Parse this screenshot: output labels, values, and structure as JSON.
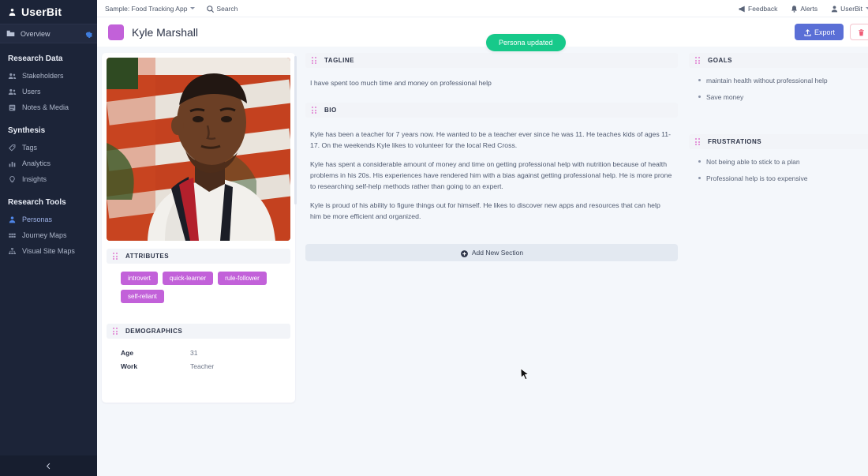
{
  "sidebar": {
    "brand": "UserBit",
    "brand_icon": "person-badge-icon",
    "overview": {
      "label": "Overview",
      "icon": "folder-icon",
      "settings_icon": "gear-icon"
    },
    "groups": [
      {
        "title": "Research Data",
        "items": [
          {
            "label": "Stakeholders",
            "icon": "people-icon",
            "active": false
          },
          {
            "label": "Users",
            "icon": "user-group-icon",
            "active": false
          },
          {
            "label": "Notes & Media",
            "icon": "notes-icon",
            "active": false
          }
        ]
      },
      {
        "title": "Synthesis",
        "items": [
          {
            "label": "Tags",
            "icon": "tag-icon",
            "active": false
          },
          {
            "label": "Analytics",
            "icon": "bar-chart-icon",
            "active": false
          },
          {
            "label": "Insights",
            "icon": "lightbulb-icon",
            "active": false
          }
        ]
      },
      {
        "title": "Research Tools",
        "items": [
          {
            "label": "Personas",
            "icon": "persona-icon",
            "active": true
          },
          {
            "label": "Journey Maps",
            "icon": "grid-icon",
            "active": false
          },
          {
            "label": "Visual Site Maps",
            "icon": "sitemap-icon",
            "active": false
          }
        ]
      }
    ],
    "collapse_icon": "chevron-left-icon"
  },
  "topbar": {
    "project": "Sample: Food Tracking App",
    "search": "Search",
    "search_icon": "search-icon",
    "feedback": "Feedback",
    "feedback_icon": "megaphone-icon",
    "alerts": "Alerts",
    "alerts_icon": "bell-icon",
    "account": "UserBit",
    "account_icon": "user-icon",
    "account_caret_icon": "chevron-down-icon"
  },
  "page": {
    "persona_name": "Kyle Marshall",
    "persona_color": "#c261d9",
    "export_label": "Export",
    "export_icon": "upload-icon",
    "delete_icon": "trash-icon",
    "toast": "Persona updated"
  },
  "left_column": {
    "photo_alt": "Portrait of Kyle Marshall",
    "attributes": {
      "title": "ATTRIBUTES",
      "tags": [
        "introvert",
        "quick-learner",
        "rule-follower",
        "self-reliant"
      ]
    },
    "demographics": {
      "title": "DEMOGRAPHICS",
      "rows": [
        {
          "key": "Age",
          "value": "31"
        },
        {
          "key": "Work",
          "value": "Teacher"
        }
      ]
    }
  },
  "middle_column": {
    "tagline": {
      "title": "TAGLINE",
      "text": "I have spent too much time and money on professional help"
    },
    "bio": {
      "title": "BIO",
      "paragraphs": [
        "Kyle has been a teacher for 7 years now. He wanted to be a teacher ever since he was 11. He teaches kids of ages 11-17. On the weekends Kyle likes to volunteer for the local Red Cross.",
        "Kyle has spent a considerable amount of money and time on getting professional help with nutrition because of health problems in his 20s. His experiences have rendered him with a bias against getting professional help. He is more prone to researching self-help methods rather than going to an expert.",
        "Kyle is proud of his ability to figure things out for himself. He likes to discover new apps and resources that can help him be more efficient and organized."
      ]
    },
    "add_section": {
      "label": "Add New Section",
      "icon": "plus-circle-icon"
    }
  },
  "right_column": {
    "goals": {
      "title": "GOALS",
      "items": [
        "maintain health without professional help",
        "Save money"
      ]
    },
    "frustrations": {
      "title": "FRUSTRATIONS",
      "items": [
        "Not being able to stick to a plan",
        "Professional help is too expensive"
      ]
    }
  }
}
